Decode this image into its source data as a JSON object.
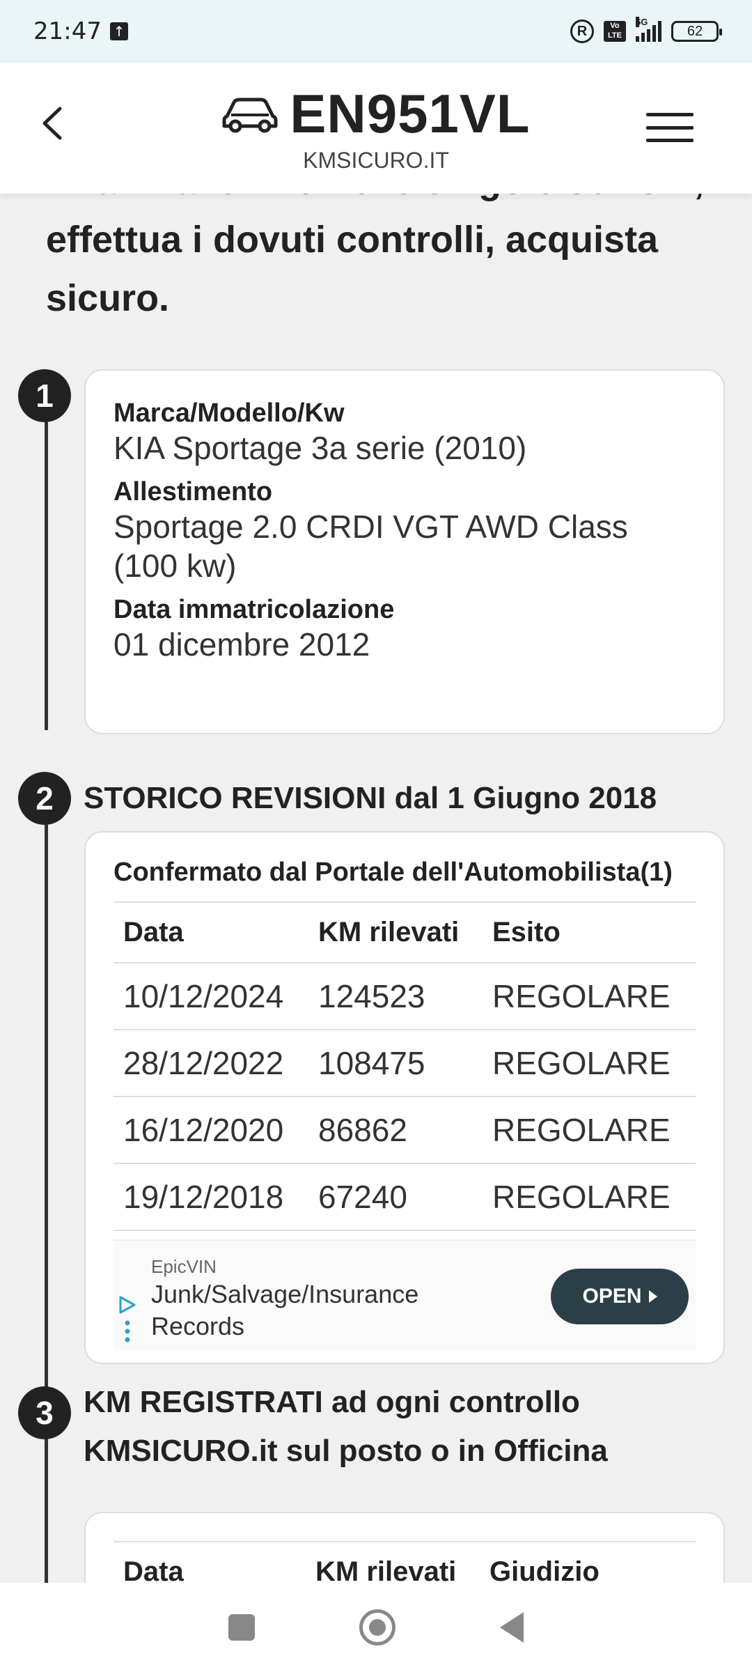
{
  "status_bar": {
    "time": "21:47",
    "network": "5G",
    "volte": "Vo LTE",
    "battery": "62",
    "r_badge": "R"
  },
  "header": {
    "plate": "EN951VL",
    "site": "KMSICURO.IT"
  },
  "intro": {
    "text": "Analizza le info nelle singole sezioni, effettua i dovuti controlli, acquista sicuro."
  },
  "section1": {
    "number": "1",
    "fields": [
      {
        "label": "Marca/Modello/Kw",
        "value": "KIA Sportage 3a serie (2010)"
      },
      {
        "label": "Allestimento",
        "value": "Sportage 2.0 CRDI VGT AWD Class (100 kw)"
      },
      {
        "label": "Data immatricolazione",
        "value": "01 dicembre 2012"
      }
    ]
  },
  "section2": {
    "number": "2",
    "title": "STORICO REVISIONI dal 1 Giugno 2018",
    "table_title": "Confermato dal Portale dell'Automobilista(1)",
    "headers": [
      "Data",
      "KM rilevati",
      "Esito"
    ],
    "rows": [
      [
        "10/12/2024",
        "124523",
        "REGOLARE"
      ],
      [
        "28/12/2022",
        "108475",
        "REGOLARE"
      ],
      [
        "16/12/2020",
        "86862",
        "REGOLARE"
      ],
      [
        "19/12/2018",
        "67240",
        "REGOLARE"
      ]
    ],
    "ad": {
      "source": "EpicVIN",
      "text": "Junk/Salvage/Insurance Records",
      "button": "OPEN"
    }
  },
  "section3": {
    "number": "3",
    "title": "KM REGISTRATI ad ogni controllo KMSICURO.it sul posto o in Officina",
    "headers": [
      "Data",
      "KM rilevati",
      "Giudizio"
    ]
  }
}
